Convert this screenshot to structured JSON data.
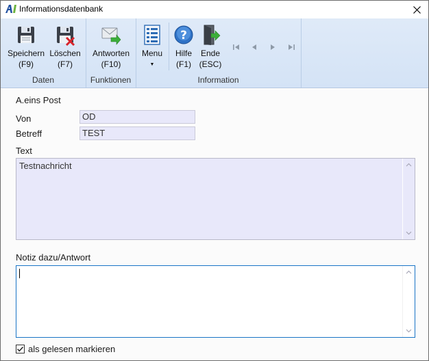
{
  "window": {
    "title": "Informationsdatenbank",
    "close_glyph": "✕"
  },
  "ribbon": {
    "groups": {
      "daten": "Daten",
      "funktionen": "Funktionen",
      "information": "Information"
    },
    "buttons": {
      "speichern": {
        "label": "Speichern",
        "shortcut": "(F9)",
        "icon": "save-floppy-icon"
      },
      "loeschen": {
        "label": "Löschen",
        "shortcut": "(F7)",
        "icon": "delete-floppy-icon"
      },
      "antworten": {
        "label": "Antworten",
        "shortcut": "(F10)",
        "icon": "reply-mail-icon"
      },
      "menu": {
        "label": "Menu",
        "caret": "▼",
        "icon": "menu-list-icon"
      },
      "hilfe": {
        "label": "Hilfe",
        "shortcut": "(F1)",
        "icon": "help-icon"
      },
      "ende": {
        "label": "Ende",
        "shortcut": "(ESC)",
        "icon": "exit-door-icon"
      }
    },
    "navigation": [
      "first-record-icon",
      "previous-record-icon",
      "next-record-icon",
      "last-record-icon"
    ]
  },
  "form": {
    "heading": "A.eins Post",
    "von_label": "Von",
    "von_value": "OD",
    "betreff_label": "Betreff",
    "betreff_value": "TEST",
    "text_label": "Text",
    "text_value": "Testnachricht",
    "note_label": "Notiz dazu/Antwort",
    "note_value": "",
    "checkbox_label": "als gelesen markieren",
    "checkbox_checked": true
  },
  "colors": {
    "ribbon": "#d4e3f6",
    "readonly_field": "#e8e8fa",
    "focus_border": "#1874c6"
  }
}
